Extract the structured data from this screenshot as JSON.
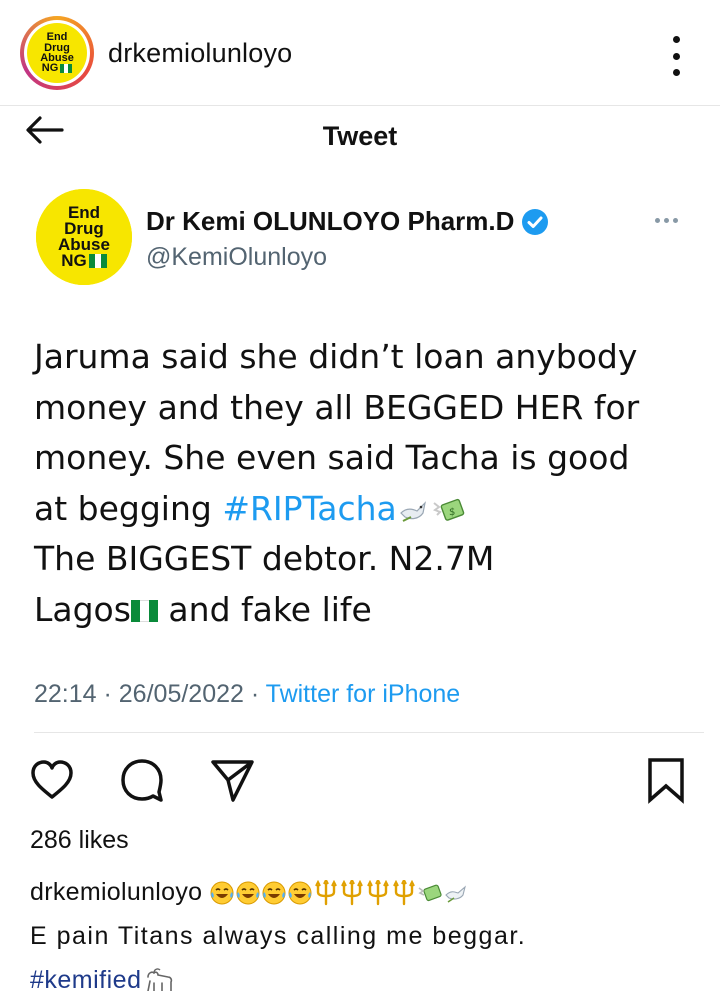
{
  "header": {
    "username": "drkemiolunloyo",
    "avatar_text": [
      "End",
      "Drug",
      "Abuse",
      "NG"
    ],
    "more_icon": "vertical-dots-icon"
  },
  "tweet": {
    "title": "Tweet",
    "back_icon": "arrow-left-icon",
    "name": "Dr Kemi OLUNLOYO Pharm.D",
    "handle": "@KemiOlunloyo",
    "avatar_text": [
      "End",
      "Drug",
      "Abuse",
      "NG"
    ],
    "verified_icon": "verified-badge-icon",
    "more_icon": "horizontal-dots-icon",
    "text_lines": [
      "Jaruma said she didn’t loan anybody",
      "money and they all BEGGED HER for",
      "money. She even said Tacha is good",
      "at begging"
    ],
    "hashtag": "#RIPTacha",
    "text_line5": "The BIGGEST debtor. N2.7M",
    "text_line6_a": "Lagos",
    "text_line6_b": " and fake life",
    "time": "22:14",
    "date": "26/05/2022",
    "source": "Twitter for iPhone",
    "emojis": [
      "dove",
      "money-with-wings",
      "nigeria-flag"
    ]
  },
  "actions": {
    "like_icon": "heart-icon",
    "comment_icon": "comment-bubble-icon",
    "share_icon": "paper-plane-icon",
    "save_icon": "bookmark-icon"
  },
  "post": {
    "likes": "286 likes",
    "caption_user": "drkemiolunloyo",
    "caption_emojis": [
      "tears-of-joy",
      "tears-of-joy",
      "tears-of-joy",
      "tears-of-joy",
      "trident",
      "trident",
      "trident",
      "trident",
      "money-with-wings",
      "dove"
    ],
    "caption_body": "E pain Titans always calling me beggar.",
    "caption_tag": "#kemified",
    "caption_tag_emoji": "goat"
  },
  "colors": {
    "twitter_blue": "#1d9bf0",
    "muted_gray": "#536471",
    "badge_yellow": "#f7e600",
    "nigeria_green": "#0a8a3a"
  }
}
